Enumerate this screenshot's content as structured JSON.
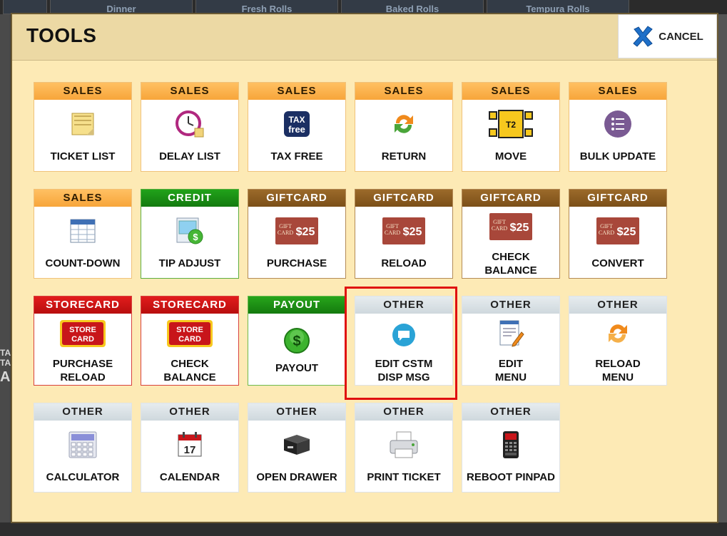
{
  "background": {
    "tabs": [
      "Dinner",
      "Fresh Rolls",
      "Baked Rolls",
      "Tempura Rolls"
    ],
    "left_text": [
      "TA",
      "TA",
      "AI"
    ]
  },
  "modal": {
    "title": "TOOLS",
    "cancel_label": "CANCEL",
    "cancel_icon": "blue-x-icon"
  },
  "tiles": [
    {
      "category": "SALES",
      "label": "TICKET LIST",
      "icon": "ticket-list-icon"
    },
    {
      "category": "SALES",
      "label": "DELAY LIST",
      "icon": "clock-icon"
    },
    {
      "category": "SALES",
      "label": "TAX FREE",
      "icon": "tax-free-icon",
      "icon_text": [
        "TAX",
        "free"
      ]
    },
    {
      "category": "SALES",
      "label": "RETURN",
      "icon": "return-arrows-icon"
    },
    {
      "category": "SALES",
      "label": "MOVE",
      "icon": "move-table-icon",
      "icon_text": "T2"
    },
    {
      "category": "SALES",
      "label": "BULK UPDATE",
      "icon": "list-circle-icon"
    },
    {
      "category": "SALES",
      "label": "COUNT-DOWN",
      "icon": "table-grid-icon"
    },
    {
      "category": "CREDIT",
      "label": "TIP ADJUST",
      "icon": "tip-adjust-icon"
    },
    {
      "category": "GIFTCARD",
      "label": "PURCHASE",
      "icon": "gift-card-icon"
    },
    {
      "category": "GIFTCARD",
      "label": "RELOAD",
      "icon": "gift-card-icon"
    },
    {
      "category": "GIFTCARD",
      "label": "CHECK\nBALANCE",
      "icon": "gift-card-icon"
    },
    {
      "category": "GIFTCARD",
      "label": "CONVERT",
      "icon": "gift-card-icon"
    },
    {
      "category": "STORECARD",
      "label": "PURCHASE\nRELOAD",
      "icon": "store-card-icon"
    },
    {
      "category": "STORECARD",
      "label": "CHECK\nBALANCE",
      "icon": "store-card-icon"
    },
    {
      "category": "PAYOUT",
      "label": "PAYOUT",
      "icon": "dollar-coin-icon"
    },
    {
      "category": "OTHER",
      "label": "EDIT CSTM\nDISP MSG",
      "icon": "message-bubble-icon",
      "highlighted": true
    },
    {
      "category": "OTHER",
      "label": "EDIT\nMENU",
      "icon": "edit-document-icon"
    },
    {
      "category": "OTHER",
      "label": "RELOAD\nMENU",
      "icon": "reload-arrows-icon"
    },
    {
      "category": "OTHER",
      "label": "CALCULATOR",
      "icon": "calculator-icon"
    },
    {
      "category": "OTHER",
      "label": "CALENDAR",
      "icon": "calendar-icon",
      "icon_text": "17"
    },
    {
      "category": "OTHER",
      "label": "OPEN DRAWER",
      "icon": "cash-drawer-icon"
    },
    {
      "category": "OTHER",
      "label": "PRINT TICKET",
      "icon": "printer-icon"
    },
    {
      "category": "OTHER",
      "label": "REBOOT PINPAD",
      "icon": "pinpad-icon"
    }
  ],
  "gift_card_text": [
    "GIFT",
    "CARD",
    "$25"
  ],
  "store_card_text": [
    "STORE",
    "CARD"
  ]
}
